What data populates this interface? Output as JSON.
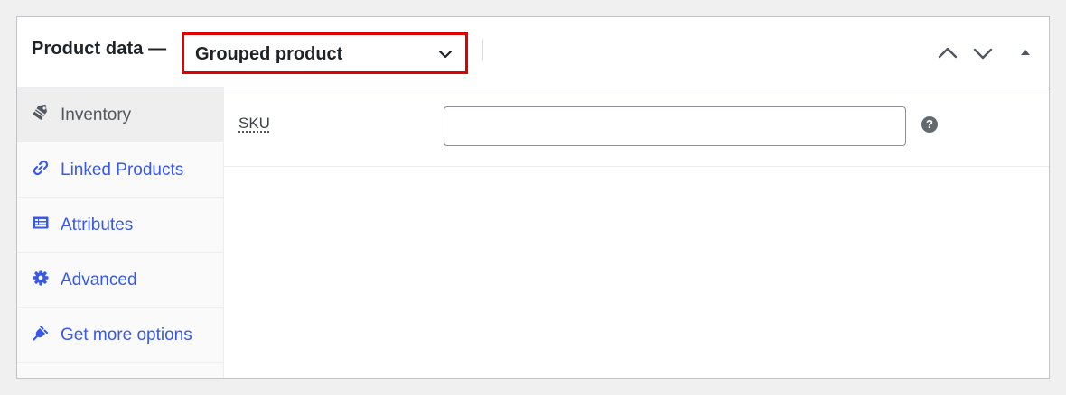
{
  "panel": {
    "title": "Product data —",
    "product_type": {
      "selected": "Grouped product",
      "icon": "chevron-down-icon"
    },
    "header_controls": [
      {
        "name": "move-up-button",
        "icon": "chevron-up-icon"
      },
      {
        "name": "move-down-button",
        "icon": "chevron-down-icon"
      },
      {
        "name": "toggle-panel-button",
        "icon": "triangle-up-icon"
      }
    ]
  },
  "tabs": [
    {
      "label": "Inventory",
      "icon": "tag-icon",
      "active": true
    },
    {
      "label": "Linked Products",
      "icon": "link-icon",
      "active": false
    },
    {
      "label": "Attributes",
      "icon": "list-card-icon",
      "active": false
    },
    {
      "label": "Advanced",
      "icon": "gear-icon",
      "active": false
    },
    {
      "label": "Get more options",
      "icon": "plugin-icon",
      "active": false
    }
  ],
  "inventory": {
    "sku_label": "SKU",
    "sku_value": "",
    "help_glyph": "?"
  },
  "colors": {
    "highlight_border": "#e00000",
    "link": "#3858e9",
    "active_tab_bg": "#eeeeee"
  }
}
